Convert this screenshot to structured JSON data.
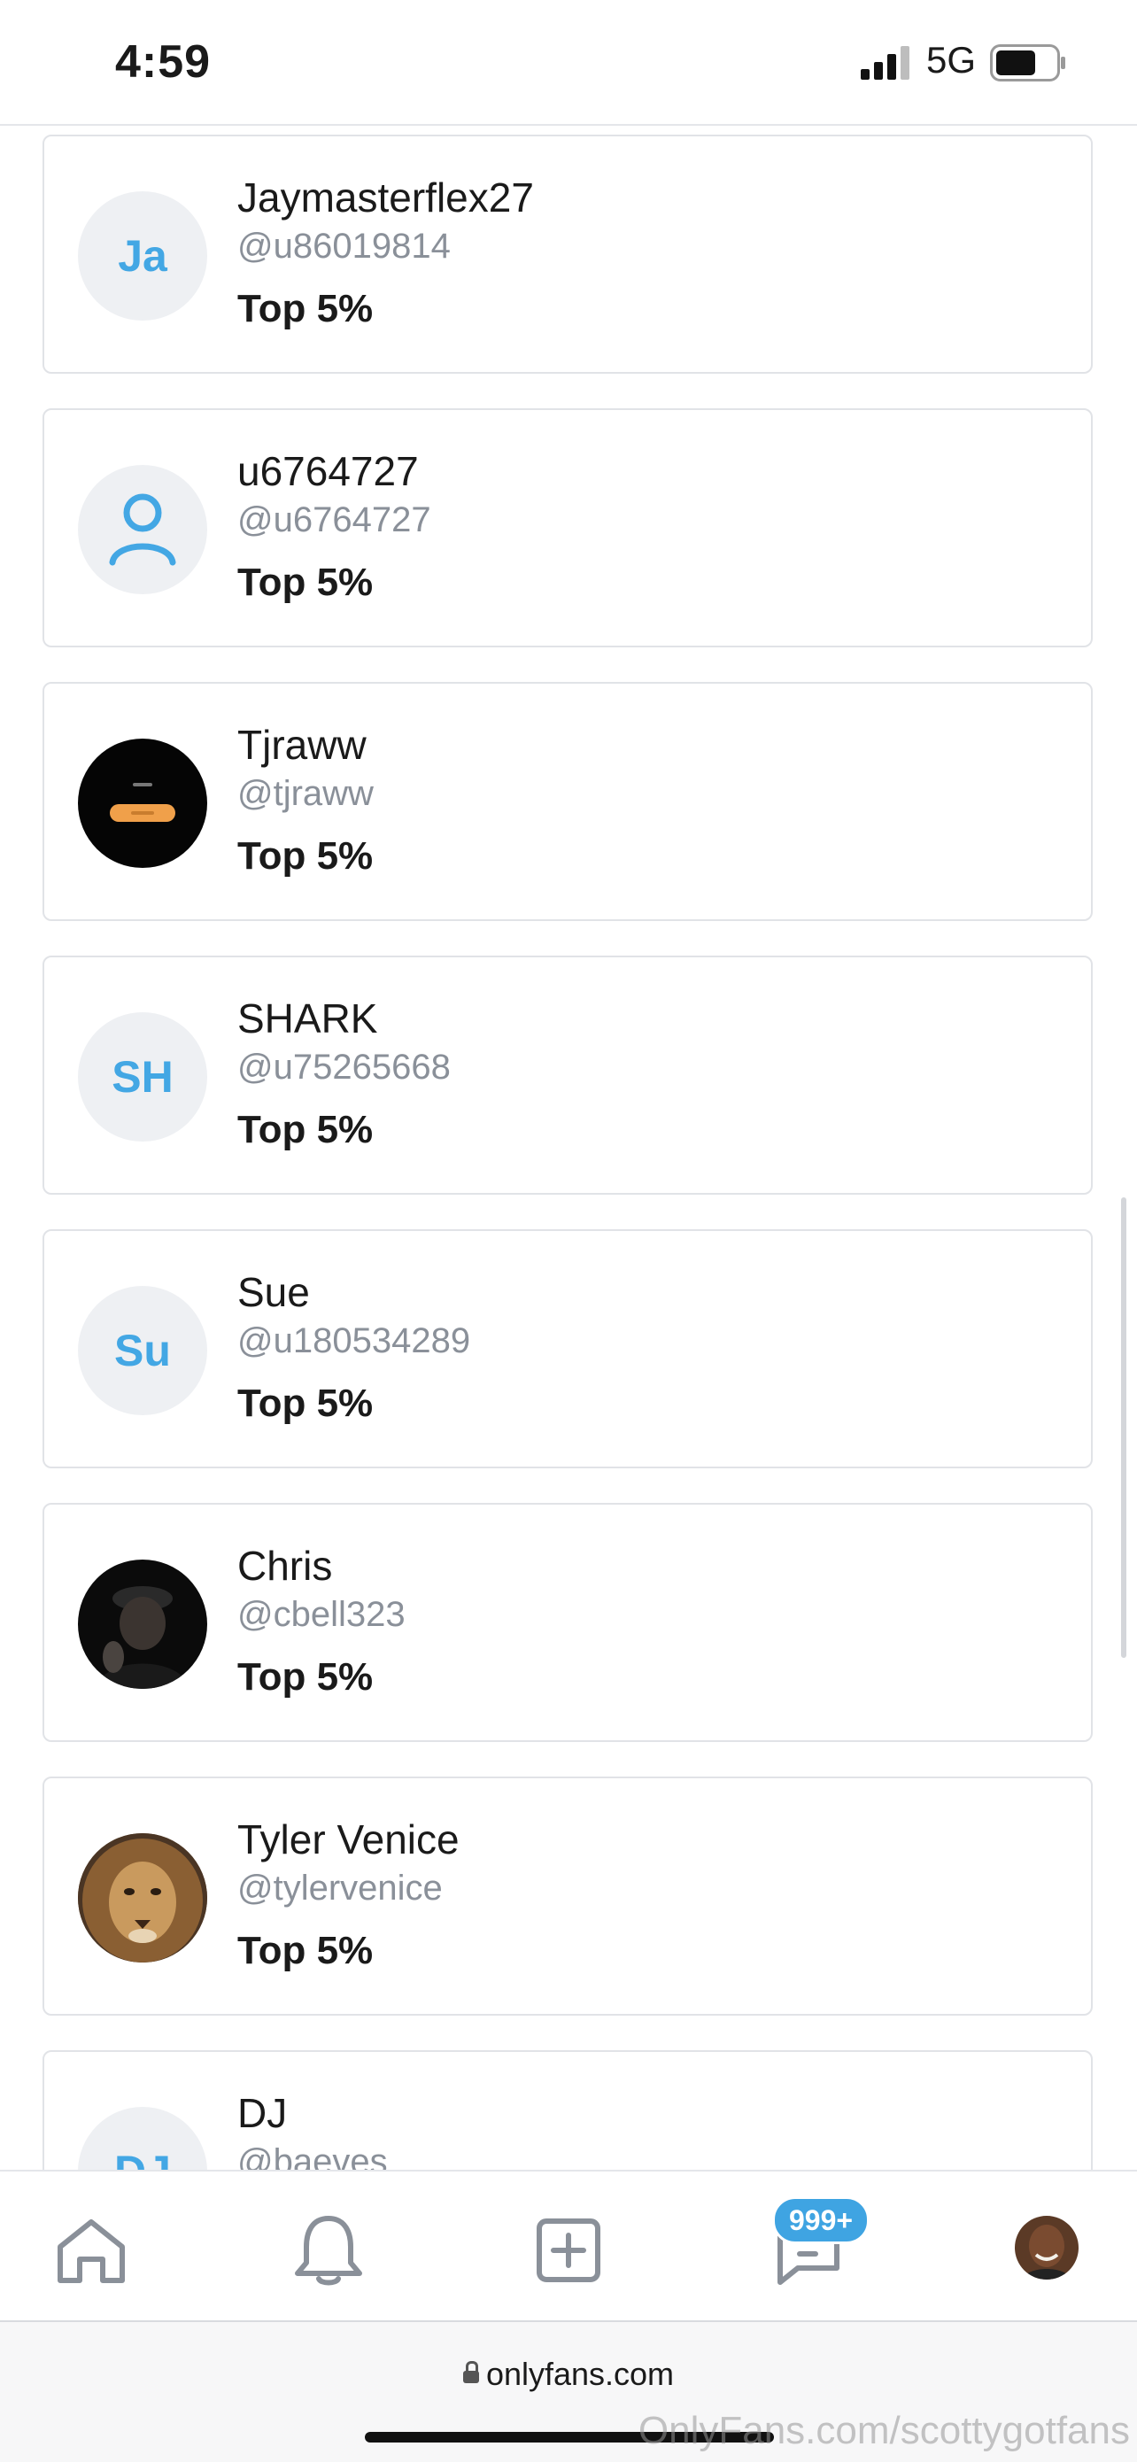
{
  "status_bar": {
    "time": "4:59",
    "network": "5G"
  },
  "users": [
    {
      "name": "Jaymasterflex27",
      "handle": "@u86019814",
      "rank": "Top 5%",
      "initials": "Ja",
      "avatar": "initials"
    },
    {
      "name": "u6764727",
      "handle": "@u6764727",
      "rank": "Top 5%",
      "initials": "",
      "avatar": "person-icon"
    },
    {
      "name": "Tjraww",
      "handle": "@tjraww",
      "rank": "Top 5%",
      "initials": "",
      "avatar": "photo-dark-alarm"
    },
    {
      "name": "SHARK",
      "handle": "@u75265668",
      "rank": "Top 5%",
      "initials": "SH",
      "avatar": "initials"
    },
    {
      "name": "Sue",
      "handle": "@u180534289",
      "rank": "Top 5%",
      "initials": "Su",
      "avatar": "initials"
    },
    {
      "name": "Chris",
      "handle": "@cbell323",
      "rank": "Top 5%",
      "initials": "",
      "avatar": "photo-person-cap"
    },
    {
      "name": "Tyler Venice",
      "handle": "@tylervenice",
      "rank": "Top 5%",
      "initials": "",
      "avatar": "photo-lion"
    },
    {
      "name": "DJ",
      "handle": "@baeves",
      "rank": "",
      "initials": "DJ",
      "avatar": "initials"
    }
  ],
  "bottom_nav": {
    "items": [
      "home-icon",
      "bell-icon",
      "add-post-icon",
      "messages-icon",
      "profile-avatar"
    ],
    "messages_badge": "999+"
  },
  "browser": {
    "url": "onlyfans.com",
    "watermark": "OnlyFans.com/scottygotfans"
  },
  "colors": {
    "accent": "#43a7e4",
    "badge": "#3fa4e2",
    "muted_text": "#8a9099"
  }
}
